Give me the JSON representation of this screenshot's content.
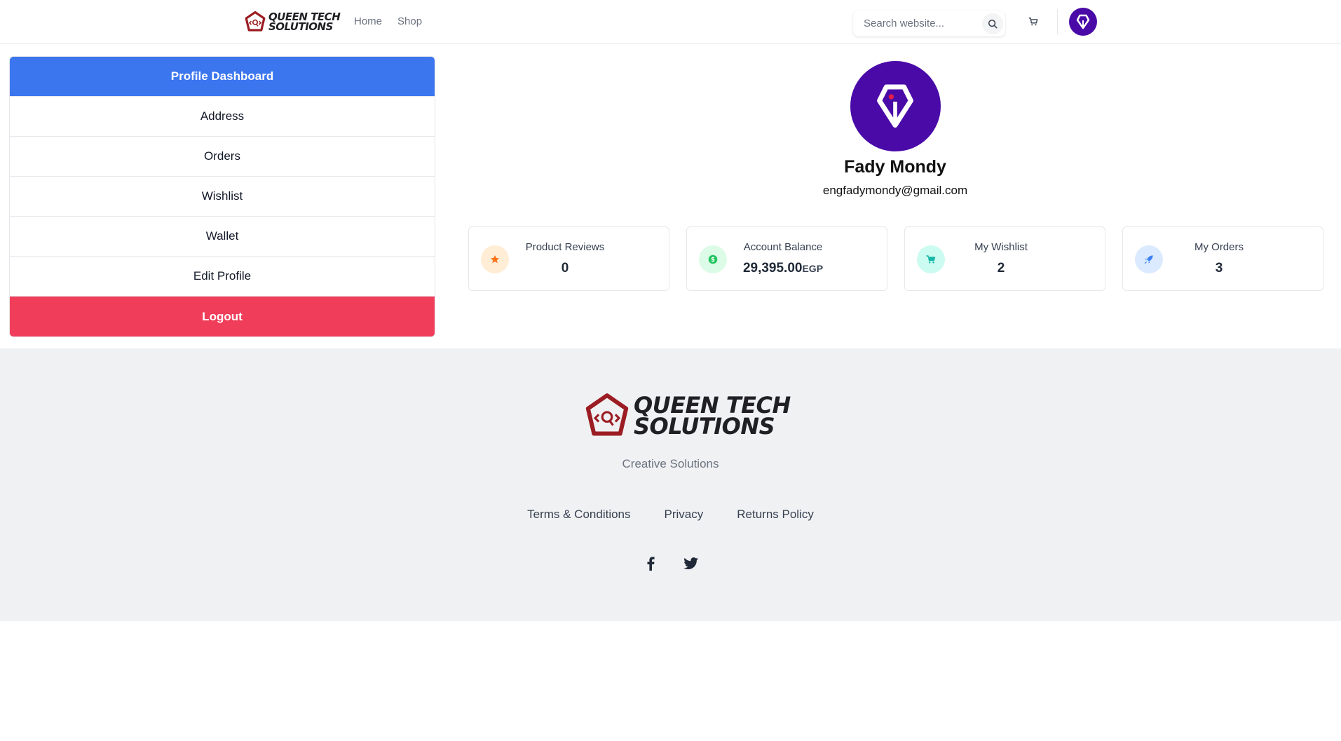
{
  "header": {
    "brand_line1": "QUEEN TECH",
    "brand_line2": "SOLUTIONS",
    "nav": [
      "Home",
      "Shop"
    ],
    "search_placeholder": "Search website...",
    "icons": {
      "search": "search-icon",
      "cart": "cart-icon",
      "avatar": "pen-nib-icon"
    }
  },
  "sidebar": {
    "items": [
      {
        "label": "Profile Dashboard",
        "state": "active"
      },
      {
        "label": "Address"
      },
      {
        "label": "Orders"
      },
      {
        "label": "Wishlist"
      },
      {
        "label": "Wallet"
      },
      {
        "label": "Edit Profile"
      },
      {
        "label": "Logout",
        "state": "danger"
      }
    ]
  },
  "profile": {
    "name": "Fady Mondy",
    "email": "engfadymondy@gmail.com"
  },
  "stats": [
    {
      "label": "Product Reviews",
      "value": "0",
      "icon": "star-icon",
      "color": "#f97316",
      "bg": "#ffedd5"
    },
    {
      "label": "Account Balance",
      "value": "29,395.00",
      "currency": "EGP",
      "icon": "dollar-icon",
      "color": "#22c55e",
      "bg": "#dcfce7"
    },
    {
      "label": "My Wishlist",
      "value": "2",
      "icon": "cart-icon",
      "color": "#14b8a6",
      "bg": "#ccfbf1"
    },
    {
      "label": "My Orders",
      "value": "3",
      "icon": "rocket-icon",
      "color": "#3b82f6",
      "bg": "#dbeafe"
    }
  ],
  "footer": {
    "brand_line1": "QUEEN TECH",
    "brand_line2": "SOLUTIONS",
    "tagline": "Creative Solutions",
    "links": [
      "Terms & Conditions",
      "Privacy",
      "Returns Policy"
    ],
    "social": [
      "facebook-icon",
      "twitter-icon"
    ]
  },
  "colors": {
    "primary": "#3b76ef",
    "danger": "#f03d5a",
    "avatar": "#4a0aa8",
    "brand_red": "#9b1c22"
  }
}
